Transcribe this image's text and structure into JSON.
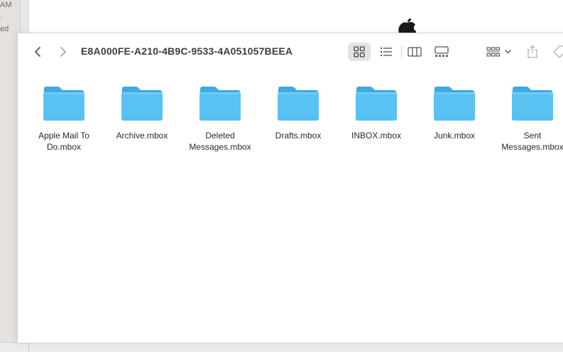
{
  "background": {
    "left_snippets": [
      "AM",
      ".",
      "ed"
    ]
  },
  "window": {
    "title": "E8A000FE-A210-4B9C-9533-4A051057BEEA"
  },
  "toolbar": {
    "back_icon": "chevron-left-icon",
    "forward_icon": "chevron-right-icon",
    "view_icon_icon": "grid-view-icon",
    "view_list_icon": "list-view-icon",
    "view_column_icon": "column-view-icon",
    "view_gallery_icon": "gallery-view-icon",
    "group_icon": "group-by-icon",
    "share_icon": "share-icon",
    "tag_icon": "tag-icon",
    "active_view": "icon"
  },
  "colors": {
    "folder_top": "#6fcdf8",
    "folder_body": "#5ac2f3",
    "folder_tab": "#3fa9e0",
    "selected_view_bg": "#e3e3e3"
  },
  "items": [
    {
      "label_line1": "Apple Mail To",
      "label_line2": "Do.mbox"
    },
    {
      "label_line1": "Archive.mbox",
      "label_line2": ""
    },
    {
      "label_line1": "Deleted",
      "label_line2": "Messages.mbox"
    },
    {
      "label_line1": "Drafts.mbox",
      "label_line2": ""
    },
    {
      "label_line1": "INBOX.mbox",
      "label_line2": ""
    },
    {
      "label_line1": "Junk.mbox",
      "label_line2": ""
    },
    {
      "label_line1": "Sent",
      "label_line2": "Messages.mbox"
    }
  ]
}
